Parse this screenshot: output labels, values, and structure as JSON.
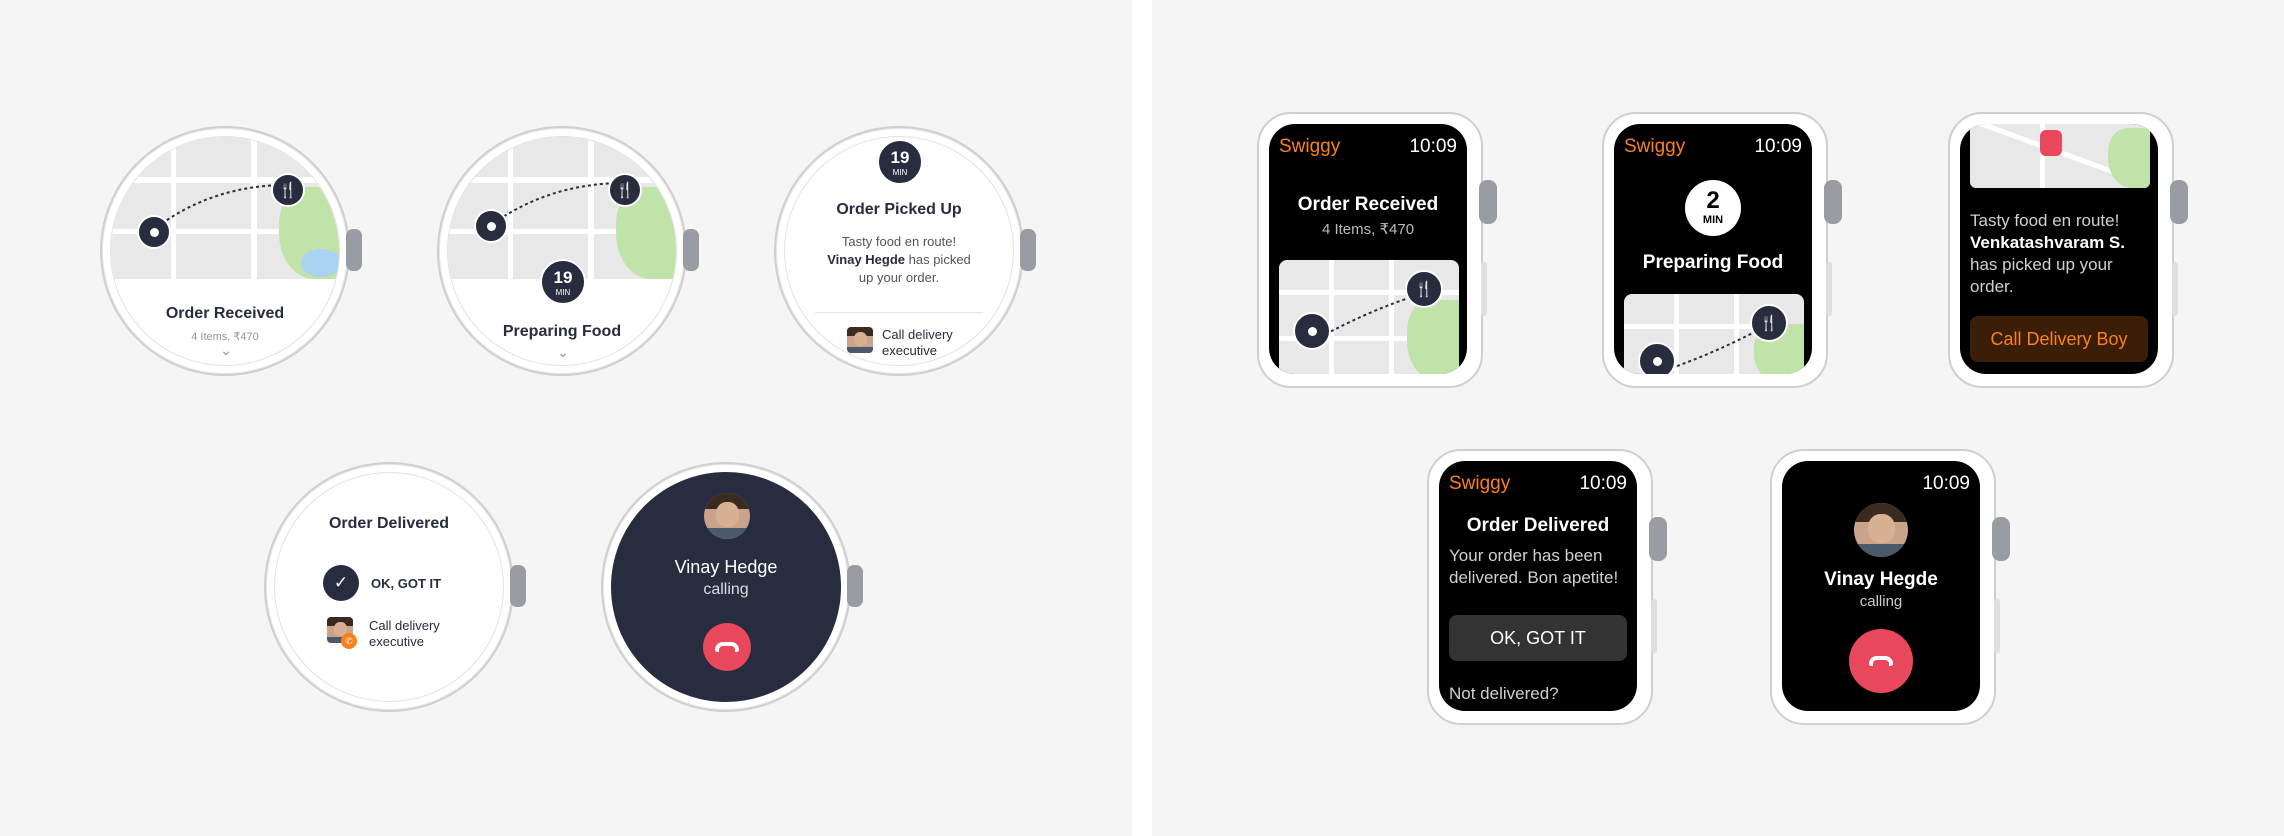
{
  "colors": {
    "brand": "#fc8019",
    "dark": "#282c3f",
    "call": "#e9475c"
  },
  "round_order_received": {
    "title": "Order Received",
    "sub": "4 Items, ₹470",
    "chevron": "⌄"
  },
  "round_preparing": {
    "title": "Preparing Food",
    "min": "19",
    "min_unit": "MIN",
    "chevron": "⌄"
  },
  "round_picked": {
    "min": "19",
    "min_unit": "MIN",
    "title": "Order Picked Up",
    "line1": "Tasty food en route!",
    "name": "Vinay Hegde",
    "line2": " has picked",
    "line3": "up your order.",
    "call": "Call delivery executive"
  },
  "round_delivered": {
    "title": "Order Delivered",
    "ok": "OK, GOT IT",
    "call1": "Call delivery",
    "call2": "executive"
  },
  "round_calling": {
    "name": "Vinay Hedge",
    "status": "calling"
  },
  "sq_order_received": {
    "brand": "Swiggy",
    "time": "10:09",
    "title": "Order Received",
    "sub": "4 Items, ₹470"
  },
  "sq_preparing": {
    "brand": "Swiggy",
    "time": "10:09",
    "min": "2",
    "min_unit": "MIN",
    "title": "Preparing Food"
  },
  "sq_picked": {
    "line1": "Tasty food en route!",
    "name": "Venkatashvaram S.",
    "line2": "has picked up your",
    "line3": "order.",
    "button": "Call Delivery Boy"
  },
  "sq_delivered": {
    "brand": "Swiggy",
    "time": "10:09",
    "title": "Order Delivered",
    "body": "Your order has been delivered. Bon apetite!",
    "ok": "OK, GOT IT",
    "not": "Not delivered?"
  },
  "sq_calling": {
    "time": "10:09",
    "name": "Vinay Hegde",
    "status": "calling"
  }
}
